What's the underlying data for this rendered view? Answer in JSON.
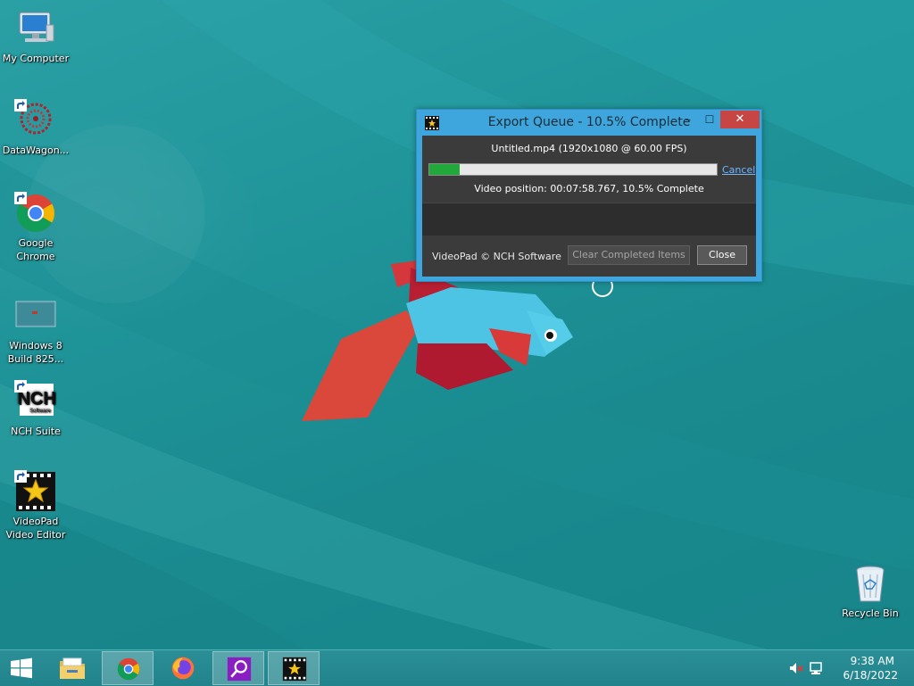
{
  "desktop": {
    "icons": [
      {
        "label": "My Computer",
        "icon": "computer-icon"
      },
      {
        "label": "DataWagon...",
        "icon": "datawagon-icon"
      },
      {
        "label": "Google Chrome",
        "icon": "chrome-icon"
      },
      {
        "label": "Windows 8 Build 825...",
        "icon": "windows8-build-icon"
      },
      {
        "label": "NCH Suite",
        "icon": "nch-suite-icon"
      },
      {
        "label": "VideoPad Video Editor",
        "icon": "videopad-icon"
      },
      {
        "label": "Recycle Bin",
        "icon": "recycle-bin-icon"
      }
    ]
  },
  "export_window": {
    "title": "Export Queue - 10.5% Complete",
    "minimize": "–",
    "maximize": "☐",
    "close": "✕",
    "file_line": "Untitled.mp4 (1920x1080 @ 60.00 FPS)",
    "progress_fraction": 0.105,
    "cancel_label": "Cancel",
    "position_line": "Video position:  00:07:58.767, 10.5% Complete",
    "brand": "VideoPad © NCH Software",
    "clear_label": "Clear Completed Items",
    "close_label": "Close",
    "accent": "#3ea6dd",
    "progress_color": "#22a83a"
  },
  "taskbar": {
    "items": [
      {
        "icon": "file-explorer-icon",
        "active": false
      },
      {
        "icon": "chrome-icon",
        "active": true
      },
      {
        "icon": "firefox-icon",
        "active": false
      },
      {
        "icon": "search-app-icon",
        "active": true
      },
      {
        "icon": "videopad-icon",
        "active": true
      }
    ],
    "time": "9:38 AM",
    "date": "6/18/2022",
    "tray": [
      "volume-muted-icon",
      "network-icon"
    ]
  }
}
